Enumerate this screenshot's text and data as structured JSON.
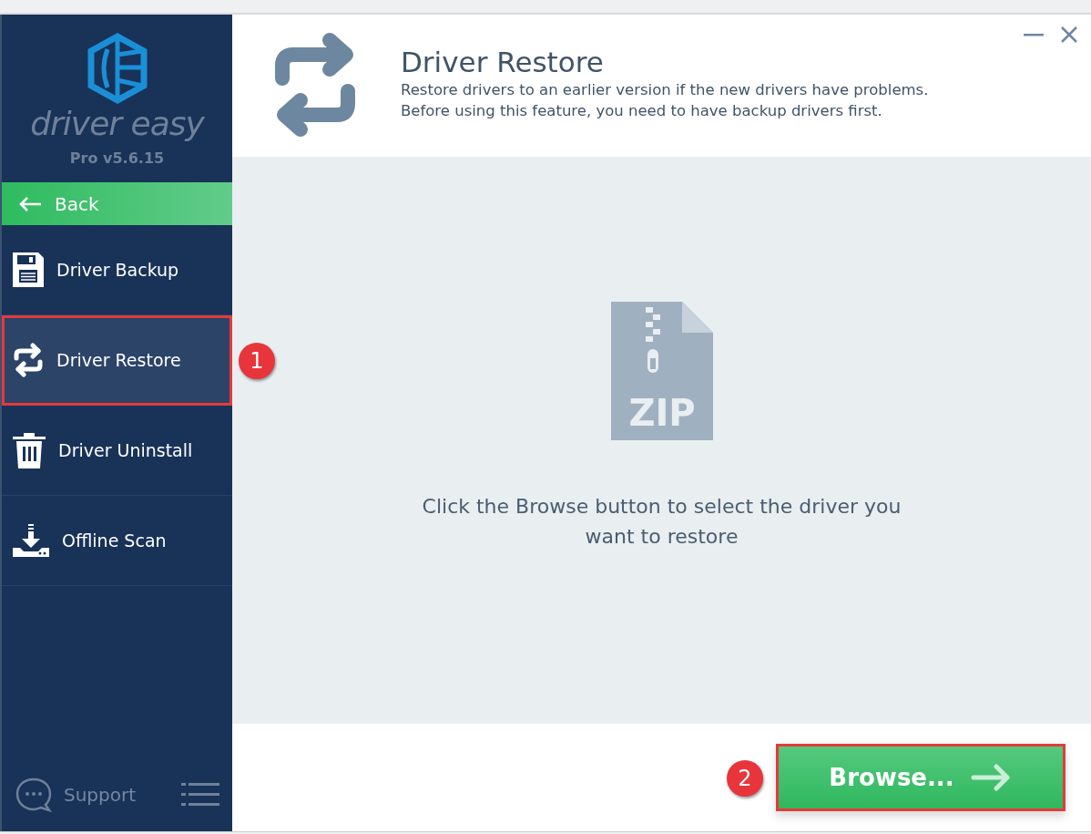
{
  "app": {
    "name": "driver easy",
    "version": "Pro v5.6.15"
  },
  "back": {
    "label": "Back"
  },
  "nav": [
    {
      "label": "Driver Backup",
      "selected": false
    },
    {
      "label": "Driver Restore",
      "selected": true,
      "callout": "1"
    },
    {
      "label": "Driver Uninstall",
      "selected": false
    },
    {
      "label": "Offline Scan",
      "selected": false
    }
  ],
  "support": {
    "label": "Support"
  },
  "header": {
    "title": "Driver Restore",
    "description": [
      "Restore drivers to an earlier version if the new drivers have problems.",
      "Before using this feature, you need to have backup drivers first."
    ]
  },
  "body": {
    "file_label": "ZIP",
    "message": "Click the Browse button to select the driver you want to restore"
  },
  "browse_button": {
    "label": "Browse...",
    "callout": "2"
  }
}
